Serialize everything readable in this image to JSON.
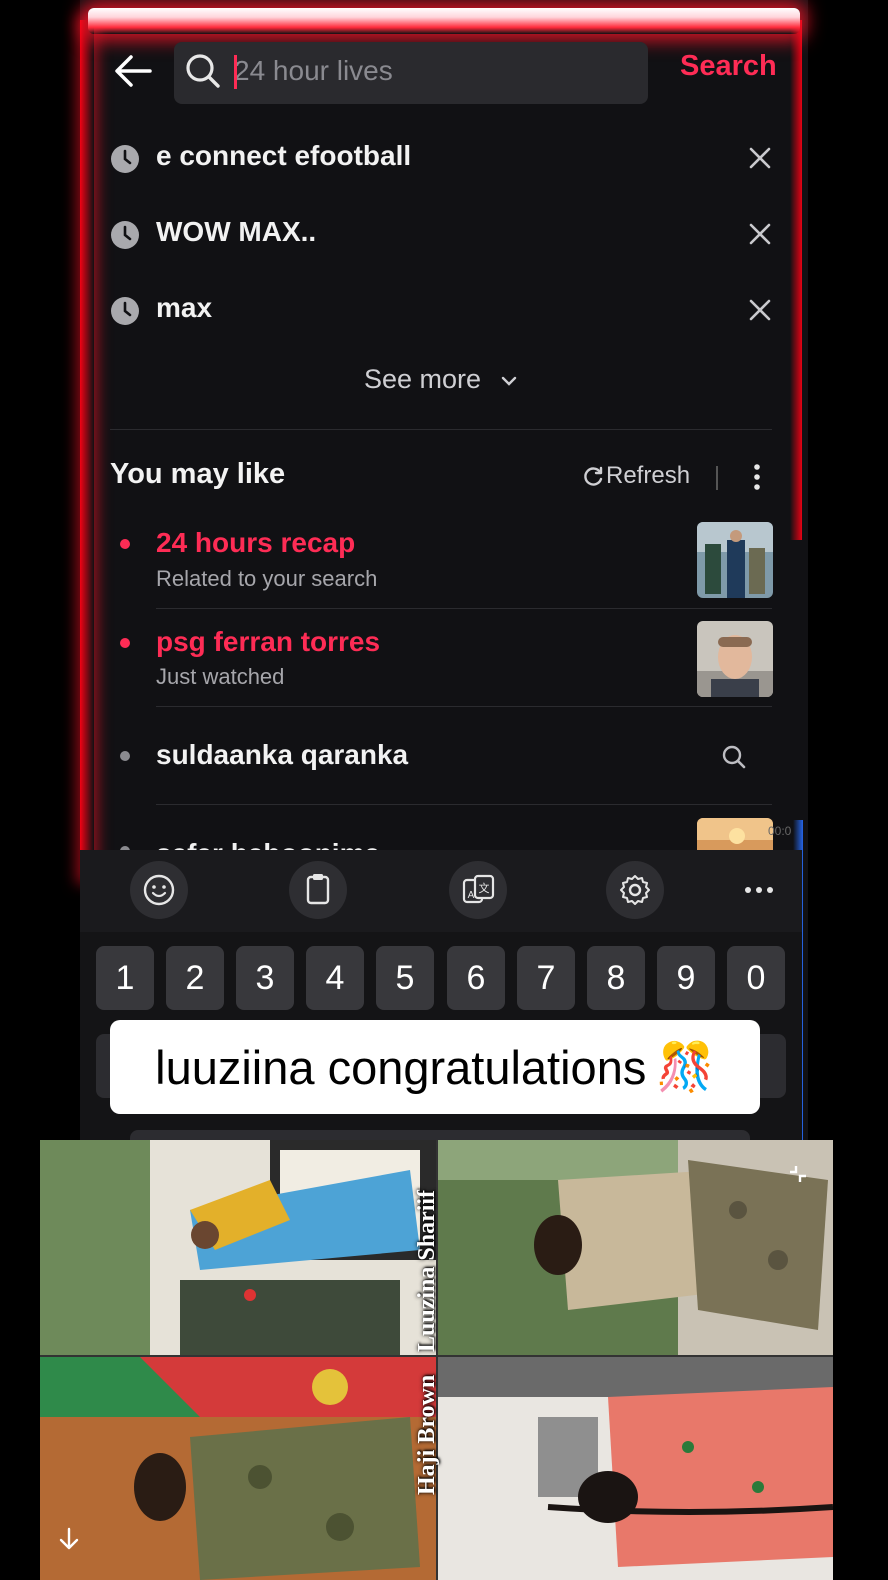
{
  "header": {
    "search_placeholder": "24 hour lives",
    "search_button": "Search"
  },
  "history": [
    {
      "label": "e connect efootball"
    },
    {
      "label": "WOW MAX.."
    },
    {
      "label": "max"
    }
  ],
  "see_more": "See more",
  "you_may_like": {
    "title": "You may like",
    "refresh": "Refresh",
    "items": [
      {
        "title": "24 hours recap",
        "subtitle": "Related to your search"
      },
      {
        "title": "psg ferran torres",
        "subtitle": "Just watched"
      },
      {
        "title": "suldaanka qaranka"
      },
      {
        "title": "safar haboonima",
        "duration": "00:0"
      }
    ]
  },
  "keyboard": {
    "number_row": [
      "1",
      "2",
      "3",
      "4",
      "5",
      "6",
      "7",
      "8",
      "9",
      "0"
    ]
  },
  "caption": {
    "text": "luuziina congratulations",
    "emoji": "🎊"
  },
  "collage": {
    "name_top": "Luuzina Shariif",
    "name_bottom": "Haji Brown"
  },
  "colors": {
    "accent": "#fe2c55",
    "background": "#111114",
    "glow_red": "#ff1a2e",
    "glow_blue": "#2a6bff"
  },
  "icons": [
    "back-arrow-icon",
    "search-icon",
    "clock-icon",
    "close-icon",
    "chevron-down-icon",
    "refresh-icon",
    "more-vertical-icon",
    "emoji-icon",
    "clipboard-icon",
    "translate-icon",
    "settings-icon",
    "more-horizontal-icon",
    "scroll-down-icon",
    "collapse-icon"
  ]
}
